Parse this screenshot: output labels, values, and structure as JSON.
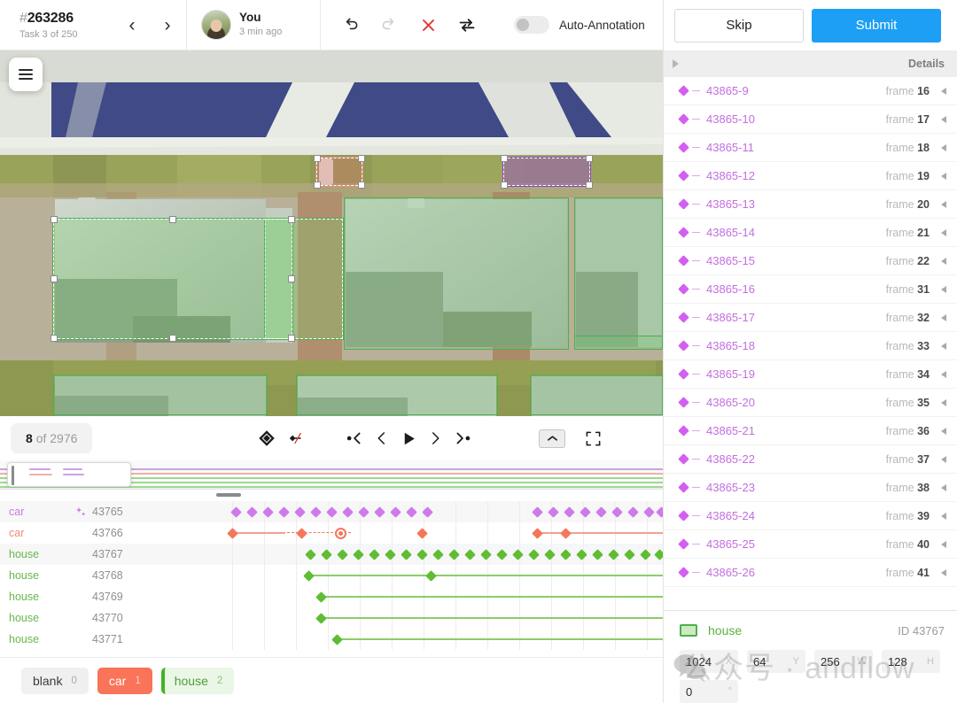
{
  "header": {
    "task_hash": "#",
    "task_id": "263286",
    "task_sub": "Task 3 of 250",
    "prev_icon": "chevron-left-icon",
    "next_icon": "chevron-right-icon",
    "user_name": "You",
    "user_time": "3 min ago",
    "undo_icon": "undo-icon",
    "redo_icon": "redo-icon",
    "delete_icon": "close-x-icon",
    "swap_icon": "swap-arrows-icon",
    "auto_annotation_label": "Auto-Annotation",
    "auto_annotation_on": false
  },
  "right": {
    "skip_label": "Skip",
    "submit_label": "Submit",
    "details_label": "Details",
    "rows": [
      {
        "name": "43865-9",
        "frame_label": "frame",
        "frame": "16"
      },
      {
        "name": "43865-10",
        "frame_label": "frame",
        "frame": "17"
      },
      {
        "name": "43865-11",
        "frame_label": "frame",
        "frame": "18"
      },
      {
        "name": "43865-12",
        "frame_label": "frame",
        "frame": "19"
      },
      {
        "name": "43865-13",
        "frame_label": "frame",
        "frame": "20"
      },
      {
        "name": "43865-14",
        "frame_label": "frame",
        "frame": "21"
      },
      {
        "name": "43865-15",
        "frame_label": "frame",
        "frame": "22"
      },
      {
        "name": "43865-16",
        "frame_label": "frame",
        "frame": "31"
      },
      {
        "name": "43865-17",
        "frame_label": "frame",
        "frame": "32"
      },
      {
        "name": "43865-18",
        "frame_label": "frame",
        "frame": "33"
      },
      {
        "name": "43865-19",
        "frame_label": "frame",
        "frame": "34"
      },
      {
        "name": "43865-20",
        "frame_label": "frame",
        "frame": "35"
      },
      {
        "name": "43865-21",
        "frame_label": "frame",
        "frame": "36"
      },
      {
        "name": "43865-22",
        "frame_label": "frame",
        "frame": "37"
      },
      {
        "name": "43865-23",
        "frame_label": "frame",
        "frame": "38"
      },
      {
        "name": "43865-24",
        "frame_label": "frame",
        "frame": "39"
      },
      {
        "name": "43865-25",
        "frame_label": "frame",
        "frame": "40"
      },
      {
        "name": "43865-26",
        "frame_label": "frame",
        "frame": "41"
      }
    ],
    "selection": {
      "label": "house",
      "id_text": "ID 43767",
      "coords": [
        {
          "key": "x",
          "value": "1024",
          "unit": "X"
        },
        {
          "key": "y",
          "value": "64",
          "unit": "Y"
        },
        {
          "key": "w",
          "value": "256",
          "unit": "W"
        },
        {
          "key": "h",
          "value": "128",
          "unit": "H"
        },
        {
          "key": "r",
          "value": "0",
          "unit": "°"
        }
      ]
    },
    "watermark": "公众号 · andflow"
  },
  "player": {
    "counter_current": "8",
    "counter_of": "of",
    "counter_total": "2976",
    "tools": [
      {
        "name": "move-keyframe-icon"
      },
      {
        "name": "delete-keyframe-icon"
      },
      {
        "name": "prev-keyframe-icon"
      },
      {
        "name": "step-back-icon"
      },
      {
        "name": "play-icon"
      },
      {
        "name": "step-forward-icon"
      },
      {
        "name": "next-keyframe-icon"
      },
      {
        "name": "collapse-panel-icon"
      },
      {
        "name": "fullscreen-icon"
      }
    ]
  },
  "timeline": {
    "tracks": [
      {
        "label": "car",
        "id": "43765",
        "color": "car-p",
        "kf_color": "p",
        "sparkle": true
      },
      {
        "label": "car",
        "id": "43766",
        "color": "car-r",
        "kf_color": "r",
        "sparkle": false
      },
      {
        "label": "house",
        "id": "43767",
        "color": "house",
        "kf_color": "g",
        "sparkle": false
      },
      {
        "label": "house",
        "id": "43768",
        "color": "house",
        "kf_color": "g",
        "sparkle": false
      },
      {
        "label": "house",
        "id": "43769",
        "color": "house",
        "kf_color": "g",
        "sparkle": false
      },
      {
        "label": "house",
        "id": "43770",
        "color": "house",
        "kf_color": "g",
        "sparkle": false
      },
      {
        "label": "house",
        "id": "43771",
        "color": "house",
        "kf_color": "g",
        "sparkle": false
      }
    ]
  },
  "chips": [
    {
      "label": "blank",
      "num": "0",
      "style": "blank"
    },
    {
      "label": "car",
      "num": "1",
      "style": "car"
    },
    {
      "label": "house",
      "num": "2",
      "style": "house"
    }
  ],
  "canvas": {
    "boxes": [
      {
        "name": "car-box-red",
        "label": "car"
      },
      {
        "name": "car-box-purple",
        "label": "car"
      },
      {
        "name": "house-box-selected",
        "label": "house"
      }
    ]
  },
  "colors": {
    "accent": "#1c9ff5",
    "car_purple": "#cf7ae8",
    "car_red": "#f4775c",
    "house_green": "#5fbd33",
    "delete_red": "#e53935"
  }
}
